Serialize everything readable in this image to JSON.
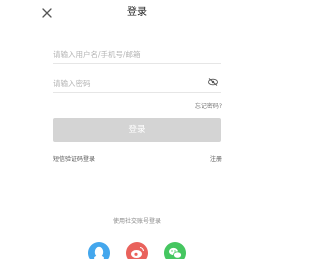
{
  "header": {
    "title": "登录",
    "close_icon": "close-icon"
  },
  "form": {
    "username_placeholder": "请输入用户名/手机号/邮箱",
    "username_value": "",
    "password_placeholder": "请输入密码",
    "password_value": "",
    "eye_icon": "eye-off-icon",
    "forgot_label": "忘记密码?",
    "login_label": "登录",
    "sms_login_label": "短信验证码登录",
    "register_label": "注册"
  },
  "social": {
    "title": "使用社交账号登录",
    "providers": [
      {
        "name": "QQ",
        "icon": "qq-icon",
        "color": "#44a7ed"
      },
      {
        "name": "微博",
        "icon": "weibo-icon",
        "color": "#e9625c"
      },
      {
        "name": "微信",
        "icon": "wechat-icon",
        "color": "#45c660"
      }
    ]
  },
  "colors": {
    "login_button_disabled": "#d4d4d4",
    "placeholder": "#b4b4b4",
    "divider": "#e6e6e6"
  }
}
